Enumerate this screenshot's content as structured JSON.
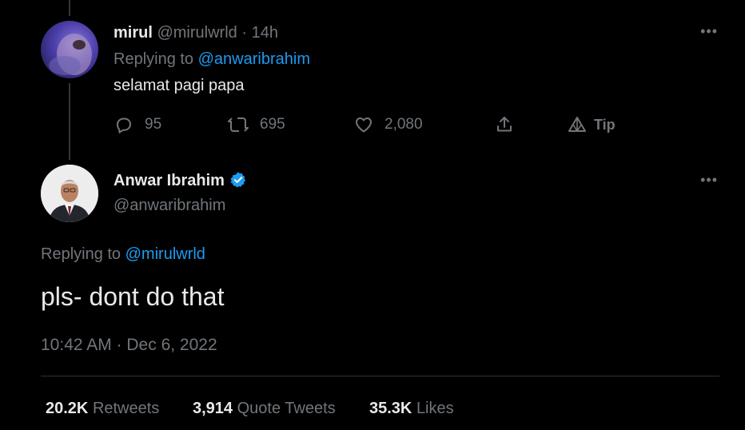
{
  "reply_tweet": {
    "display_name": "mirul",
    "handle": "@mirulwrld",
    "separator": "·",
    "time": "14h",
    "replying_prefix": "Replying to",
    "replying_handle": "@anwaribrahim",
    "text": "selamat pagi papa",
    "actions": {
      "reply_count": "95",
      "retweet_count": "695",
      "like_count": "2,080",
      "tip_label": "Tip"
    },
    "icons": [
      "more-icon",
      "reply-icon",
      "retweet-icon",
      "like-icon",
      "share-icon",
      "tip-icon"
    ]
  },
  "main_tweet": {
    "display_name": "Anwar Ibrahim",
    "verified": true,
    "handle": "@anwaribrahim",
    "replying_prefix": "Replying to",
    "replying_handle": "@mirulwrld",
    "text": "pls- dont do that",
    "timestamp": "10:42 AM · Dec 6, 2022",
    "stats": {
      "retweets_value": "20.2K",
      "retweets_label": "Retweets",
      "quote_value": "3,914",
      "quote_label": "Quote Tweets",
      "likes_value": "35.3K",
      "likes_label": "Likes"
    }
  },
  "colors": {
    "background": "#000000",
    "text": "#e7e9ea",
    "muted": "#71767b",
    "link": "#1d9bf0",
    "verified": "#1d9bf0",
    "divider": "#2f3336"
  }
}
